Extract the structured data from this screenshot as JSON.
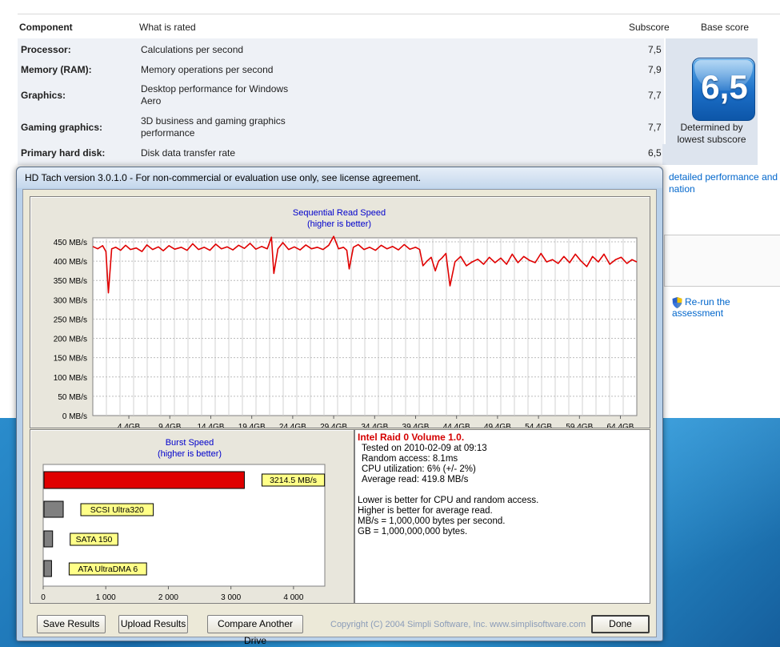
{
  "wei": {
    "columns": {
      "component": "Component",
      "rated": "What is rated",
      "subscore": "Subscore",
      "base": "Base score"
    },
    "rows": [
      {
        "component": "Processor:",
        "rated": "Calculations per second",
        "subscore": "7,5"
      },
      {
        "component": "Memory (RAM):",
        "rated": "Memory operations per second",
        "subscore": "7,9"
      },
      {
        "component": "Graphics:",
        "rated": "Desktop performance for Windows Aero",
        "subscore": "7,7"
      },
      {
        "component": "Gaming graphics:",
        "rated": "3D business and gaming graphics performance",
        "subscore": "7,7"
      },
      {
        "component": "Primary hard disk:",
        "rated": "Disk data transfer rate",
        "subscore": "6,5"
      }
    ],
    "base_score": "6,5",
    "base_caption": "Determined by lowest subscore",
    "link_detail": "detailed performance and",
    "link_detail2": "nation",
    "rerun": "Re-run the assessment"
  },
  "hdtach": {
    "title": "HD Tach version 3.0.1.0  - For non-commercial or evaluation use only, see license agreement.",
    "info": {
      "drive": "Intel Raid 0 Volume 1.0.",
      "lines": [
        "Tested on 2010-02-09 at 09:13",
        "Random access: 8.1ms",
        "CPU utilization: 6% (+/- 2%)",
        "Average read: 419.8 MB/s"
      ],
      "notes": [
        "Lower is better for CPU and random access.",
        "Higher is better for average read.",
        "MB/s = 1,000,000 bytes per second.",
        "GB = 1,000,000,000 bytes."
      ]
    },
    "buttons": {
      "save": "Save Results",
      "upload": "Upload Results",
      "compare": "Compare Another Drive",
      "done": "Done"
    },
    "copyright": "Copyright (C) 2004 Simpli Software, Inc. www.simplisoftware.com",
    "colors": {
      "series": "#e00000",
      "title_text": "#0000cc",
      "label_bg": "#ffff88",
      "ref_bar": "#808080"
    }
  },
  "chart_data": [
    {
      "type": "line",
      "title": "Sequential Read Speed",
      "subtitle": "(higher is better)",
      "ylim": [
        0,
        450
      ],
      "yticks": [
        0,
        50,
        100,
        150,
        200,
        250,
        300,
        350,
        400,
        450
      ],
      "ytick_labels": [
        "0 MB/s",
        "50 MB/s",
        "100 MB/s",
        "150 MB/s",
        "200 MB/s",
        "250 MB/s",
        "300 MB/s",
        "350 MB/s",
        "400 MB/s",
        "450 MB/s"
      ],
      "xlim": [
        0,
        66.4
      ],
      "xticks": [
        4.4,
        9.4,
        14.4,
        19.4,
        24.4,
        29.4,
        34.4,
        39.4,
        44.4,
        49.4,
        54.4,
        59.4,
        64.4
      ],
      "xtick_labels": [
        "4,4GB",
        "9,4GB",
        "14,4GB",
        "19,4GB",
        "24,4GB",
        "29,4GB",
        "34,4GB",
        "39,4GB",
        "44,4GB",
        "49,4GB",
        "54,4GB",
        "59,4GB",
        "64,4GB"
      ],
      "grid": true,
      "series": [
        {
          "x": [
            0.0,
            0.6,
            1.2,
            1.6,
            1.9,
            2.3,
            2.8,
            3.4,
            4.0,
            4.6,
            5.3,
            6.0,
            6.6,
            7.3,
            8.0,
            8.6,
            9.3,
            10.0,
            10.8,
            11.5,
            12.2,
            12.9,
            13.6,
            14.3,
            15.0,
            15.7,
            16.4,
            17.1,
            17.8,
            18.5,
            19.2,
            19.9,
            20.6,
            21.3,
            21.8,
            22.1,
            22.6,
            23.2,
            23.9,
            24.6,
            25.3,
            26.0,
            26.7,
            27.4,
            28.1,
            28.8,
            29.4,
            30.0,
            30.6,
            31.0,
            31.3,
            31.8,
            32.4,
            33.1,
            33.8,
            34.5,
            35.2,
            35.9,
            36.6,
            37.3,
            38.0,
            38.7,
            39.4,
            39.9,
            40.3,
            40.8,
            41.3,
            41.8,
            42.2,
            42.6,
            43.1,
            43.6,
            44.2,
            44.9,
            45.6,
            46.3,
            47.0,
            47.7,
            48.4,
            49.1,
            49.8,
            50.5,
            51.2,
            51.9,
            52.6,
            53.3,
            54.0,
            54.7,
            55.4,
            56.1,
            56.8,
            57.5,
            58.2,
            58.9,
            59.6,
            60.3,
            61.0,
            61.7,
            62.4,
            63.1,
            63.8,
            64.5,
            65.2,
            65.8,
            66.4
          ],
          "y": [
            438,
            432,
            440,
            425,
            318,
            432,
            436,
            428,
            441,
            430,
            434,
            425,
            442,
            430,
            437,
            427,
            440,
            431,
            436,
            428,
            445,
            430,
            436,
            428,
            444,
            432,
            437,
            429,
            441,
            433,
            446,
            431,
            438,
            432,
            462,
            368,
            432,
            448,
            430,
            437,
            429,
            442,
            432,
            436,
            430,
            441,
            464,
            432,
            436,
            428,
            380,
            436,
            443,
            430,
            436,
            428,
            441,
            432,
            438,
            429,
            443,
            431,
            436,
            430,
            388,
            400,
            410,
            375,
            400,
            408,
            420,
            336,
            398,
            412,
            388,
            398,
            405,
            392,
            410,
            396,
            408,
            392,
            418,
            396,
            412,
            402,
            396,
            420,
            398,
            404,
            394,
            412,
            396,
            418,
            400,
            386,
            412,
            398,
            418,
            392,
            404,
            410,
            394,
            404,
            398
          ]
        }
      ]
    },
    {
      "type": "bar",
      "orientation": "horizontal",
      "title": "Burst Speed",
      "subtitle": "(higher is better)",
      "xlim": [
        0,
        4500
      ],
      "xticks": [
        0,
        1000,
        2000,
        3000,
        4000
      ],
      "xtick_labels": [
        "0",
        "1 000",
        "2 000",
        "3 000",
        "4 000"
      ],
      "categories": [
        "3214.5 MB/s",
        "SCSI Ultra320",
        "SATA 150",
        "ATA UltraDMA 6"
      ],
      "values": [
        3214.5,
        320,
        150,
        133
      ]
    }
  ]
}
